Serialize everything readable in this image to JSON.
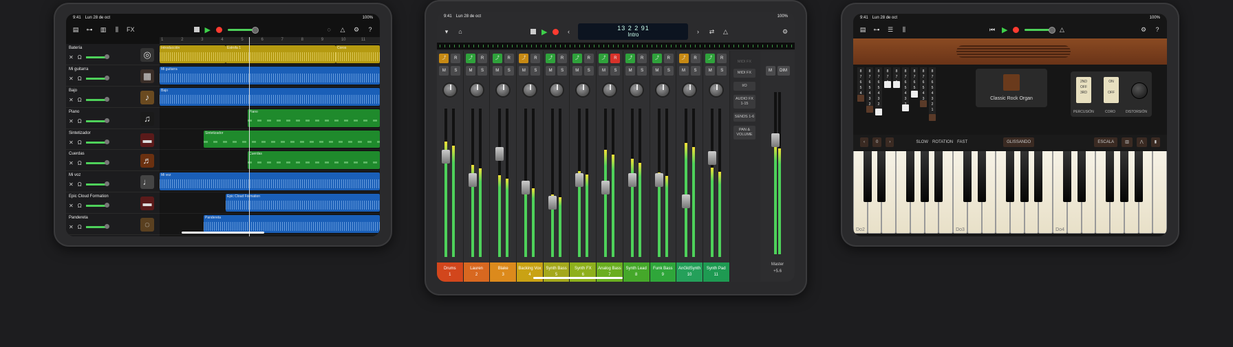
{
  "status": {
    "time": "9:41",
    "date": "Lun 28 de oct",
    "battery": "100%"
  },
  "tracks": {
    "items": [
      {
        "name": "Batería",
        "icon": "drum-kit-icon",
        "color": "#b59a10",
        "regions": [
          {
            "label": "Introducción",
            "type": "audio",
            "start": 0,
            "end": 0.3,
            "color": "yellow"
          },
          {
            "label": "Estrofa 1",
            "type": "audio",
            "start": 0.3,
            "end": 0.8,
            "color": "yellow"
          },
          {
            "label": "Coros",
            "type": "audio",
            "start": 0.8,
            "end": 1.0,
            "color": "yellow"
          }
        ]
      },
      {
        "name": "Mi guitarra",
        "icon": "amp-icon",
        "regions": [
          {
            "label": "Mi guitarra",
            "type": "audio",
            "start": 0,
            "end": 1.0,
            "color": "blue"
          }
        ]
      },
      {
        "name": "Bajo",
        "icon": "bass-guitar-icon",
        "regions": [
          {
            "label": "Bajo",
            "type": "audio",
            "start": 0,
            "end": 1.0,
            "color": "blue"
          }
        ]
      },
      {
        "name": "Piano",
        "icon": "piano-icon",
        "regions": [
          {
            "label": "Piano",
            "type": "midi",
            "start": 0.4,
            "end": 1.0,
            "color": "green"
          }
        ]
      },
      {
        "name": "Sintetizador",
        "icon": "synth-keyboard-icon",
        "regions": [
          {
            "label": "Sintetizador",
            "type": "midi",
            "start": 0.2,
            "end": 1.0,
            "color": "green"
          }
        ]
      },
      {
        "name": "Cuerdas",
        "icon": "violin-icon",
        "regions": [
          {
            "label": "Cuerdas",
            "type": "midi",
            "start": 0.4,
            "end": 1.0,
            "color": "green"
          }
        ]
      },
      {
        "name": "Mi voz",
        "icon": "microphone-icon",
        "regions": [
          {
            "label": "Mi voz",
            "type": "audio",
            "start": 0,
            "end": 1.0,
            "color": "blue"
          }
        ]
      },
      {
        "name": "Epic Cloud Formation",
        "icon": "synth-keyboard-icon",
        "regions": [
          {
            "label": "Epic Cloud Formation",
            "type": "audio",
            "start": 0.3,
            "end": 1.0,
            "color": "blue"
          }
        ]
      },
      {
        "name": "Pandereta",
        "icon": "tambourine-icon",
        "regions": [
          {
            "label": "Pandereta",
            "type": "audio",
            "start": 0.2,
            "end": 1.0,
            "color": "blue"
          }
        ]
      }
    ],
    "ruler": [
      "1",
      "2",
      "3",
      "4",
      "5",
      "6",
      "7",
      "8",
      "9",
      "10",
      "11"
    ],
    "fx_label": "FX"
  },
  "mixer": {
    "lcd": {
      "position": "13 2 2   91",
      "section": "Intro"
    },
    "channels": [
      {
        "name": "Drums",
        "num": "1",
        "color": "#d2461c",
        "meter": 0.78,
        "fader": 0.63,
        "automation": "orange",
        "rec": false
      },
      {
        "name": "Lauren",
        "num": "2",
        "color": "#d86820",
        "meter": 0.62,
        "fader": 0.47,
        "automation": "green",
        "rec": false
      },
      {
        "name": "Blake",
        "num": "3",
        "color": "#dc8a1c",
        "meter": 0.55,
        "fader": 0.65,
        "automation": "green",
        "rec": false
      },
      {
        "name": "Backing Vox",
        "num": "4",
        "color": "#c9a214",
        "meter": 0.48,
        "fader": 0.42,
        "automation": "orange",
        "rec": false
      },
      {
        "name": "Synth Bass",
        "num": "5",
        "color": "#a4a81c",
        "meter": 0.42,
        "fader": 0.32,
        "automation": "green",
        "rec": false
      },
      {
        "name": "Synth FX",
        "num": "6",
        "color": "#8eb01c",
        "meter": 0.58,
        "fader": 0.47,
        "automation": "green",
        "rec": false
      },
      {
        "name": "Analog Bass",
        "num": "7",
        "color": "#6aae20",
        "meter": 0.72,
        "fader": 0.42,
        "automation": "green",
        "rec": true
      },
      {
        "name": "Synth Lead",
        "num": "8",
        "color": "#45a82a",
        "meter": 0.66,
        "fader": 0.47,
        "automation": "green",
        "rec": false
      },
      {
        "name": "Funk Bass",
        "num": "9",
        "color": "#2fa63a",
        "meter": 0.57,
        "fader": 0.47,
        "automation": "green",
        "rec": false
      },
      {
        "name": "AnGldSynth",
        "num": "10",
        "color": "#24a05a",
        "meter": 0.77,
        "fader": 0.33,
        "automation": "orange",
        "rec": false
      },
      {
        "name": "Synth Pad",
        "num": "11",
        "color": "#1e9a52",
        "meter": 0.6,
        "fader": 0.62,
        "automation": "green",
        "rec": false
      }
    ],
    "side": {
      "header": "MIDI FX",
      "buttons": [
        "MIDI FX",
        "I/O",
        "AUDIO FX 1-15",
        "SENDS 1-6",
        "PAN & VOLUME"
      ]
    },
    "master": {
      "m_label": "M",
      "dim_label": "DIM",
      "name": "Master",
      "value": "+5.6",
      "meter": 0.68
    },
    "btn_m": "M",
    "btn_s": "S",
    "btn_r": "R"
  },
  "organ": {
    "preset_name": "Classic Rock Organ",
    "drawbars": [
      [
        "8",
        "7",
        "6",
        "5",
        "4",
        "3",
        "2",
        "1"
      ],
      [
        "8",
        "7",
        "6",
        "5",
        "4",
        "3",
        "2",
        "1"
      ],
      [
        "8",
        "7",
        "6",
        "5",
        "4",
        "3",
        "2",
        "1"
      ],
      [
        "8",
        "7",
        "6",
        "5",
        "4",
        "3",
        "2",
        "1"
      ],
      [
        "8",
        "7",
        "6",
        "5",
        "4",
        "3",
        "2",
        "1"
      ],
      [
        "8",
        "7",
        "6",
        "5",
        "4",
        "3",
        "2",
        "1"
      ],
      [
        "8",
        "7",
        "6",
        "5",
        "4",
        "3",
        "2",
        "1"
      ],
      [
        "8",
        "7",
        "6",
        "5",
        "4",
        "3",
        "2",
        "1"
      ],
      [
        "8",
        "7",
        "6",
        "5",
        "4",
        "3",
        "2",
        "1"
      ]
    ],
    "percussion": {
      "sw1_top": "2ND",
      "sw1_mid": "OFF",
      "sw1_bot": "3RD",
      "sw1_label": "PERCUSIÓN",
      "sw2_top": "ON",
      "sw2_bot": "OFF",
      "sw2_label": "CORO",
      "knob_label": "DISTORSIÓN"
    },
    "strip": {
      "octave_value": "0",
      "rotation_slow": "SLOW",
      "rotation_fast": "FAST",
      "rotation_label": "ROTATION",
      "glissando": "GLISSANDO",
      "scale": "ESCALA"
    },
    "octave_labels": [
      "Do2",
      "Do3",
      "Do4"
    ]
  }
}
